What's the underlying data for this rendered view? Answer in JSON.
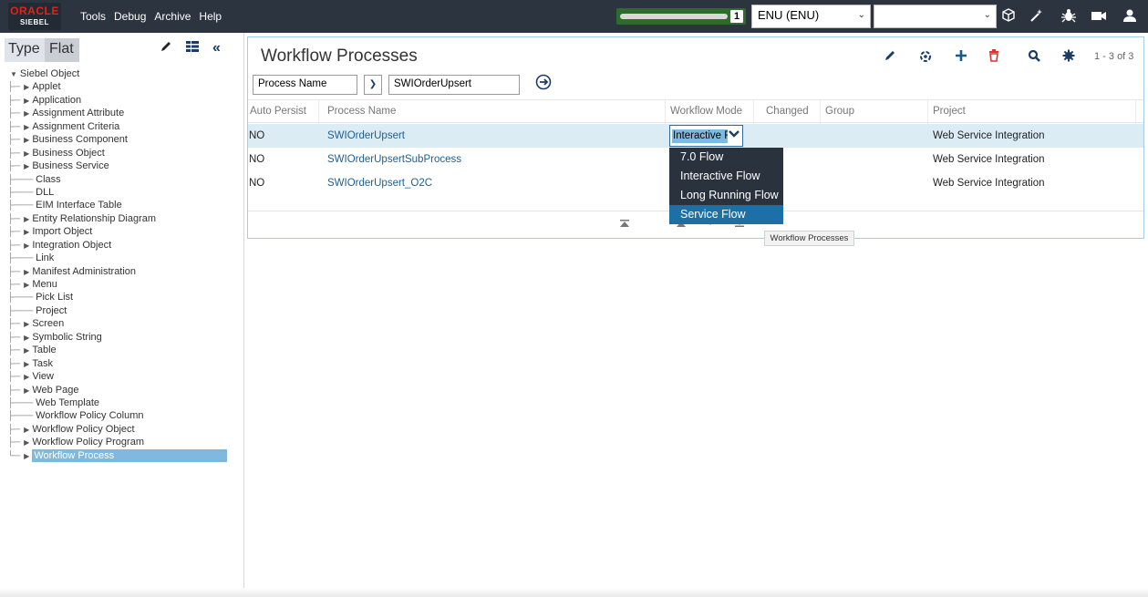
{
  "app": {
    "logo_brand": "ORACLE",
    "logo_product": "SIEBEL"
  },
  "menu": [
    "Tools",
    "Debug",
    "Archive",
    "Help"
  ],
  "busy": {
    "count": "1"
  },
  "language": {
    "value": "ENU (ENU)"
  },
  "search_select": {
    "value": ""
  },
  "top_icons": [
    "cube-icon",
    "magic-wand-icon",
    "bug-icon",
    "video-icon",
    "user-icon"
  ],
  "left": {
    "tabs": {
      "type": "Type",
      "flat": "Flat"
    },
    "root": "Siebel Object",
    "items": [
      {
        "label": "Applet",
        "expandable": true
      },
      {
        "label": "Application",
        "expandable": true
      },
      {
        "label": "Assignment Attribute",
        "expandable": true
      },
      {
        "label": "Assignment Criteria",
        "expandable": true
      },
      {
        "label": "Business Component",
        "expandable": true
      },
      {
        "label": "Business Object",
        "expandable": true
      },
      {
        "label": "Business Service",
        "expandable": true
      },
      {
        "label": "Class",
        "expandable": false
      },
      {
        "label": "DLL",
        "expandable": false
      },
      {
        "label": "EIM Interface Table",
        "expandable": false
      },
      {
        "label": "Entity Relationship Diagram",
        "expandable": true
      },
      {
        "label": "Import Object",
        "expandable": true
      },
      {
        "label": "Integration Object",
        "expandable": true
      },
      {
        "label": "Link",
        "expandable": false
      },
      {
        "label": "Manifest Administration",
        "expandable": true
      },
      {
        "label": "Menu",
        "expandable": true
      },
      {
        "label": "Pick List",
        "expandable": false
      },
      {
        "label": "Project",
        "expandable": false
      },
      {
        "label": "Screen",
        "expandable": true
      },
      {
        "label": "Symbolic String",
        "expandable": true
      },
      {
        "label": "Table",
        "expandable": true
      },
      {
        "label": "Task",
        "expandable": true
      },
      {
        "label": "View",
        "expandable": true
      },
      {
        "label": "Web Page",
        "expandable": true
      },
      {
        "label": "Web Template",
        "expandable": false
      },
      {
        "label": "Workflow Policy Column",
        "expandable": false
      },
      {
        "label": "Workflow Policy Object",
        "expandable": true
      },
      {
        "label": "Workflow Policy Program",
        "expandable": true
      },
      {
        "label": "Workflow Process",
        "expandable": true,
        "selected": true
      }
    ]
  },
  "main": {
    "title": "Workflow Processes",
    "record_count": "1 - 3 of 3",
    "query": {
      "field": "Process Name",
      "value": "SWIOrderUpsert"
    },
    "columns": [
      "Auto Persist",
      "Process Name",
      "Workflow Mode",
      "Changed",
      "Group",
      "Project"
    ],
    "rows": [
      {
        "auto_persist": "NO",
        "process_name": "SWIOrderUpsert",
        "workflow_mode": "Interactive Flow",
        "changed": "",
        "group": "",
        "project": "Web Service Integration",
        "selected": true
      },
      {
        "auto_persist": "NO",
        "process_name": "SWIOrderUpsertSubProcess",
        "workflow_mode": "",
        "changed": "",
        "group": "",
        "project": "Web Service Integration"
      },
      {
        "auto_persist": "NO",
        "process_name": "SWIOrderUpsert_O2C",
        "workflow_mode": "",
        "changed": "",
        "group": "",
        "project": "Web Service Integration"
      }
    ],
    "mode_editor_value": "Interactive F",
    "mode_options": [
      "7.0 Flow",
      "Interactive Flow",
      "Long Running Flow",
      "Service Flow"
    ],
    "mode_active": "Service Flow",
    "tooltip": "Workflow Processes"
  },
  "colors": {
    "topbar": "#2c3440",
    "accent": "#1d70a5",
    "link": "#1d5f8f",
    "selection": "#7fb9dd",
    "brand_red": "#e2231a"
  }
}
